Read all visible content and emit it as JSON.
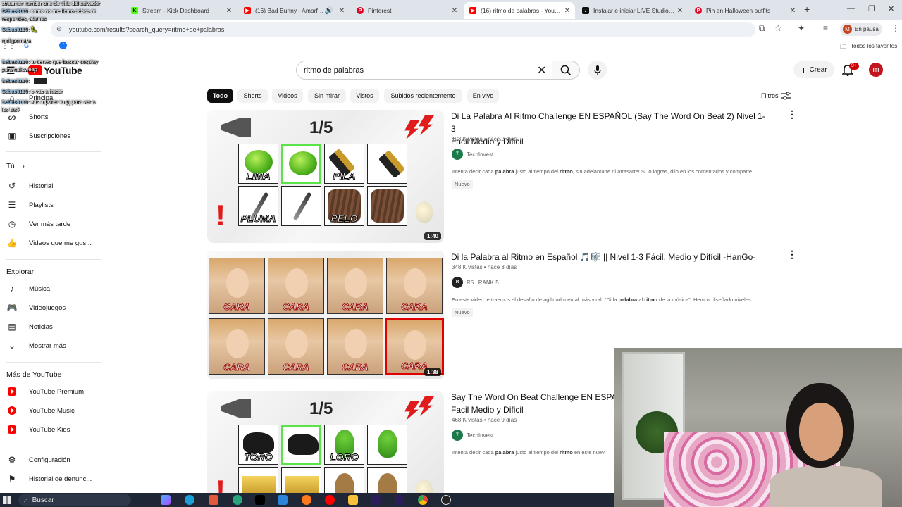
{
  "browser": {
    "tabs": [
      {
        "title": "Stream - Kick Dashboard",
        "color": "#53fc18",
        "glyph": "K"
      },
      {
        "title": "(16) Bad Bunny - Amorfoda",
        "color": "#ff0000",
        "glyph": "▶"
      },
      {
        "title": "Pinterest",
        "color": "#e60023",
        "glyph": "P"
      },
      {
        "title": "(16) ritmo de palabras - YouTube",
        "color": "#ff0000",
        "glyph": "▶",
        "active": true
      },
      {
        "title": "Instalar e iniciar LIVE Studio | C",
        "color": "#111111",
        "glyph": "♪"
      },
      {
        "title": "Pin en Halloween outfits",
        "color": "#e60023",
        "glyph": "P"
      }
    ],
    "url": "youtube.com/results?search_query=ritmo+de+palabras",
    "profile_label": "En pausa",
    "profile_initial": "M",
    "bookmarks_label": "Todos los favoritos"
  },
  "chat_overlay": [
    {
      "nick": "",
      "text": "streamer number one de villa del salvador"
    },
    {
      "nick": "Sebas8110",
      "text": "como no me llamo sebas ni"
    },
    {
      "nick": "",
      "text": "respondes, alamos"
    },
    {
      "nick": "Sebas8110",
      "text": "🐛"
    },
    {
      "nick": "",
      "text": "moli pomara"
    },
    {
      "nick": "Sebas8110",
      "text": "tu tienes que buscar cosplay"
    },
    {
      "nick": "",
      "text": "para halloween"
    },
    {
      "nick": "Sebas8110",
      "text": ""
    },
    {
      "nick": "Sebas8110",
      "text": "o vas a hacer"
    },
    {
      "nick": "Sebas8110",
      "text": "vas a poner tu pj para ver a"
    },
    {
      "nick": "",
      "text": "los bts?"
    }
  ],
  "youtube": {
    "logo": "YouTube",
    "search_query": "ritmo de palabras",
    "create_label": "Crear",
    "notif_count": "9+",
    "avatar_initial": "m",
    "sidebar": {
      "top": [
        {
          "label": "Principal",
          "icon": "home-icon"
        },
        {
          "label": "Shorts",
          "icon": "shorts-icon"
        },
        {
          "label": "Suscripciones",
          "icon": "subscriptions-icon"
        }
      ],
      "you_heading": "Tú",
      "you": [
        {
          "label": "Historial",
          "icon": "history-icon"
        },
        {
          "label": "Playlists",
          "icon": "playlist-icon"
        },
        {
          "label": "Ver más tarde",
          "icon": "clock-icon"
        },
        {
          "label": "Videos que me gus...",
          "icon": "thumbs-up-icon"
        }
      ],
      "explore_heading": "Explorar",
      "explore": [
        {
          "label": "Música",
          "icon": "music-icon"
        },
        {
          "label": "Videojuegos",
          "icon": "gamepad-icon"
        },
        {
          "label": "Noticias",
          "icon": "news-icon"
        },
        {
          "label": "Mostrar más",
          "icon": "chevron-down-icon"
        }
      ],
      "more_heading": "Más de YouTube",
      "more": [
        {
          "label": "YouTube Premium",
          "icon": "youtube-premium-icon"
        },
        {
          "label": "YouTube Music",
          "icon": "youtube-music-icon"
        },
        {
          "label": "YouTube Kids",
          "icon": "youtube-kids-icon"
        }
      ],
      "settings": [
        {
          "label": "Configuración",
          "icon": "gear-icon"
        },
        {
          "label": "Historial de denunc...",
          "icon": "flag-icon"
        }
      ]
    },
    "chips": [
      "Todo",
      "Shorts",
      "Videos",
      "Sin mirar",
      "Vistos",
      "Subidos recientemente",
      "En vivo"
    ],
    "filters_label": "Filtros",
    "results": [
      {
        "title_line1": "Di La Palabra Al Ritmo Challenge EN ESPAÑOL (Say The Word On Beat 2) Nivel 1-3",
        "title_line2": "Facil Medio y Dificil",
        "views": "123 K vistas",
        "age": "hace 2 días",
        "channel": "TechInvest",
        "channel_color": "#1b7a4a",
        "channel_glyph": "T",
        "desc_before": "Intenta decir cada ",
        "desc_b1": "palabra",
        "desc_mid": " justo al tiempo del ",
        "desc_b2": "ritmo",
        "desc_after": ", sin adelantarte ni atrasarte! Si lo logras, dilo en los comentarios y comparte ...",
        "badge": "Nuevo",
        "duration": "1:40",
        "thumb_fraction": "1/5",
        "words": [
          "LIMA",
          "",
          "PILA",
          "",
          "PLUMA",
          "",
          "PELO",
          ""
        ]
      },
      {
        "title_line1": "Di la Palabra al Ritmo en Español 🎵🎼 || Nivel 1-3 Fácil, Medio y Difícil -HanGo-",
        "title_line2": "",
        "views": "348 K vistas",
        "age": "hace 3 días",
        "channel": "R5 | RANK 5",
        "channel_color": "#222222",
        "channel_glyph": "R",
        "desc_before": "En este video te traemos el desafío de agilidad mental más viral: \"Di la ",
        "desc_b1": "palabra",
        "desc_mid": " al ",
        "desc_b2": "ritmo",
        "desc_after": " de la música\". Hemos diseñado niveles ...",
        "badge": "Nuevo",
        "duration": "1:38",
        "thumb_fraction": "",
        "words": [
          "CARA",
          "CARA",
          "CARA",
          "CARA",
          "CARA",
          "CARA",
          "CARA",
          "CARA"
        ]
      },
      {
        "title_line1": "Say The Word On Beat Challenge EN ESPAÑOL",
        "title_line2": "Facil Medio y Dificil",
        "views": "468 K vistas",
        "age": "hace 9 días",
        "channel": "TechInvest",
        "channel_color": "#1b7a4a",
        "channel_glyph": "T",
        "desc_before": "Intenta decir cada ",
        "desc_b1": "palabra",
        "desc_mid": " justo al tiempo del ",
        "desc_b2": "ritmo",
        "desc_after": " en este nuev",
        "badge": "",
        "duration": "",
        "thumb_fraction": "1/5",
        "words": [
          "TORO",
          "",
          "LORO",
          "",
          "",
          "",
          "",
          ""
        ]
      }
    ]
  },
  "taskbar": {
    "search_label": "Buscar"
  }
}
